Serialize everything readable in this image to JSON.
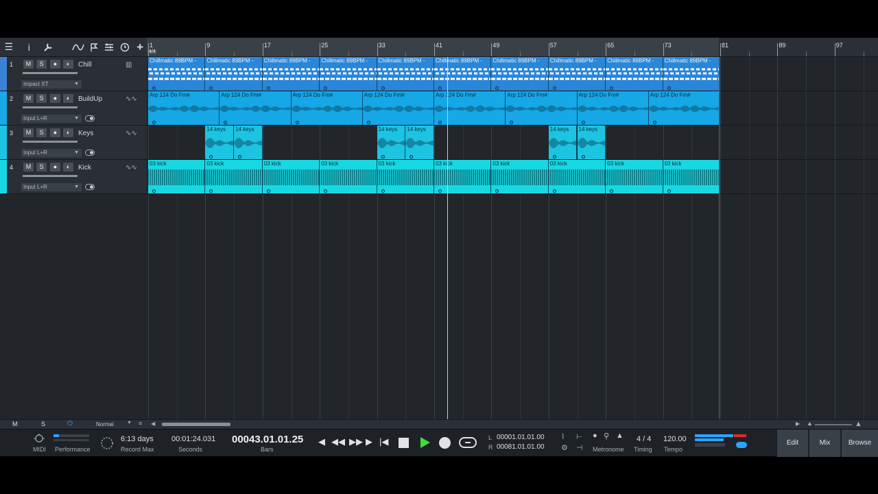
{
  "toolbar": {
    "icons": [
      "menu-icon",
      "info-icon",
      "wrench-icon",
      "automation-icon",
      "flag-icon",
      "mixer-icon",
      "clock-icon",
      "add-icon"
    ]
  },
  "ruler": {
    "time_signature": "4/4",
    "bar_numbers": [
      "1",
      "9",
      "17",
      "25",
      "33",
      "41",
      "49",
      "57",
      "65",
      "73",
      "81",
      "89",
      "97"
    ]
  },
  "tracks": [
    {
      "num": "1",
      "name": "Chill",
      "input": "Impact XT",
      "color": "#3b82d6",
      "type": "instrument"
    },
    {
      "num": "2",
      "name": "BuildUp",
      "input": "Input L+R",
      "color": "#1aa8e6",
      "type": "audio"
    },
    {
      "num": "3",
      "name": "Keys",
      "input": "Input L+R",
      "color": "#1cc4e2",
      "type": "audio"
    },
    {
      "num": "4",
      "name": "Kick",
      "input": "Input L+R",
      "color": "#17d8e2",
      "type": "audio"
    }
  ],
  "track_buttons": {
    "mute": "M",
    "solo": "S"
  },
  "clips": {
    "chill_label": "Chillmatic 89BPM -",
    "arp_label": "Arp 124 Do Fm#",
    "keys_label": "14 keys",
    "kick_label": "03 kick"
  },
  "footer_left": {
    "m": "M",
    "s": "S",
    "mode": "Normal"
  },
  "transport": {
    "midi_label": "MIDI",
    "performance_label": "Performance",
    "record_max_value": "6:13 days",
    "record_max_label": "Record Max",
    "seconds_value": "00:01:24.031",
    "seconds_label": "Seconds",
    "bars_value": "00043.01.01.25",
    "bars_label": "Bars",
    "loop_l_label": "L",
    "loop_l_value": "00001.01.01.00",
    "loop_r_label": "R",
    "loop_r_value": "00081.01.01.00",
    "metronome_label": "Metronome",
    "timing_value": "4 / 4",
    "timing_label": "Timing",
    "tempo_value": "120.00",
    "tempo_label": "Tempo"
  },
  "views": {
    "edit": "Edit",
    "mix": "Mix",
    "browse": "Browse"
  },
  "colors": {
    "accent": "#1aa8e6",
    "play": "#3ddc3d",
    "record_meter": "#e02a2a"
  }
}
